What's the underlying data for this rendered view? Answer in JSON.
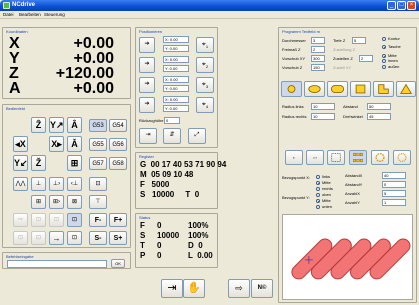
{
  "app": {
    "title": "NCdrive"
  },
  "menu": [
    "Datei",
    "Bearbeiten",
    "Steuerung"
  ],
  "koordinaten": {
    "title": "Koordinaten",
    "axes": [
      {
        "name": "X",
        "value": "+0.00"
      },
      {
        "name": "Y",
        "value": "+0.00"
      },
      {
        "name": "Z",
        "value": "+120.00"
      },
      {
        "name": "A",
        "value": "+0.00"
      }
    ]
  },
  "bedienfeld": {
    "title": "Bedienfeld",
    "gcodes": [
      "G53",
      "G54",
      "G55",
      "G56",
      "G57",
      "G58"
    ],
    "bottom": [
      "F-",
      "F+",
      "S-",
      "S+"
    ]
  },
  "befehlseingabe": {
    "title": "Befehlseingabe",
    "ok": "OK"
  },
  "positionieren": {
    "title": "Positionieren",
    "rows": [
      {
        "x": "X: 0.00",
        "y": "Y: 0.00",
        "n": "1"
      },
      {
        "x": "X: 0.00",
        "y": "Y: 0.00",
        "n": "2"
      },
      {
        "x": "X: 0.00",
        "y": "Y: 0.00",
        "n": "3"
      },
      {
        "x": "X: 0.00",
        "y": "Y: 0.00",
        "n": "4"
      }
    ],
    "rueck_label": "Rückzughöhe",
    "rueck_value": "0"
  },
  "register": {
    "title": "Register",
    "lines": [
      "G  00 17 40 53 71 90 94",
      "M  05 09 10 48",
      "F   5000",
      "S   10000     T  0"
    ]
  },
  "status": {
    "title": "Status",
    "lines": [
      [
        "F",
        "0",
        "100%"
      ],
      [
        "S",
        "10000",
        "100%"
      ],
      [
        "T",
        "0",
        "D  0"
      ],
      [
        "P",
        "0",
        "L  0.00"
      ]
    ]
  },
  "programm": {
    "title": "Programm Textfeld m",
    "durchmesser": {
      "label": "Durchmesser",
      "value": "3"
    },
    "tiefe": {
      "label": "Tiefe Z",
      "value": "5"
    },
    "freimass": {
      "label": "Freimaß Z",
      "value": "2"
    },
    "zustellung_dim": "Zustellung Z",
    "vorschub_xy": {
      "label": "Vorschub XY",
      "value": "300"
    },
    "zustellen_z": {
      "label": "Zustellen Z",
      "value": "2"
    },
    "vorschub_z": {
      "label": "Vorschub Z",
      "value": "150"
    },
    "zustell_dim": "Zustell XY",
    "options": [
      {
        "label": "Kontur",
        "on": false
      },
      {
        "label": "Tasche",
        "on": true
      },
      {
        "label": "Mitte",
        "on": true
      },
      {
        "label": "innen",
        "on": false
      },
      {
        "label": "außen",
        "on": false
      }
    ],
    "radius_links": {
      "label": "Radius links",
      "value": "10"
    },
    "abstand": {
      "label": "Abstand",
      "value": "50"
    },
    "radius_rechts": {
      "label": "Radius rechts",
      "value": "10"
    },
    "drehwinkel": {
      "label": "Drehwinkel",
      "value": "45"
    },
    "bezugspunkt_x": {
      "label": "Bezugspunkt X:",
      "opts": [
        {
          "label": "links",
          "on": false
        },
        {
          "label": "Mitte",
          "on": true
        },
        {
          "label": "rechts",
          "on": false
        }
      ]
    },
    "bezugspunkt_y": {
      "label": "Bezugspunkt Y:",
      "opts": [
        {
          "label": "oben",
          "on": false
        },
        {
          "label": "Mitte",
          "on": true
        },
        {
          "label": "unten",
          "on": false
        }
      ]
    },
    "abstand_x": {
      "label": "AbstandX",
      "value": "40"
    },
    "abstand_y": {
      "label": "AbstandY",
      "value": "0"
    },
    "anzahl_x": {
      "label": "AnzahlX",
      "value": "5"
    },
    "anzahl_y": {
      "label": "AnzahlY",
      "value": "1"
    }
  },
  "colors": {
    "accent": "#1c44b8",
    "slot_fill": "#f26d6d",
    "slot_stroke": "#c03a3a"
  }
}
